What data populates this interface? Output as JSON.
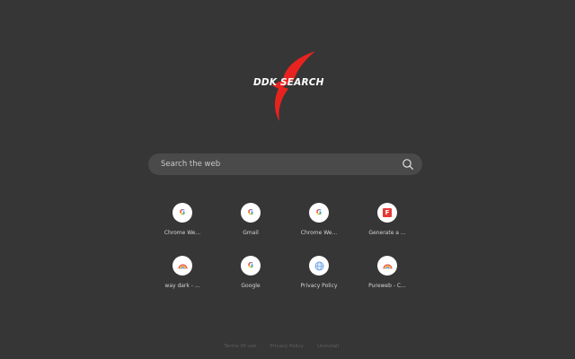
{
  "logo": {
    "text": "DDK SEARCH",
    "accent_color": "#e8231f"
  },
  "search": {
    "placeholder": "Search the web",
    "icon": "search-icon"
  },
  "shortcuts": [
    {
      "label": "Chrome We...",
      "icon": "google-g-icon"
    },
    {
      "label": "Gmail",
      "icon": "google-g-icon"
    },
    {
      "label": "Chrome We...",
      "icon": "google-g-icon"
    },
    {
      "label": "Generate a ...",
      "icon": "f-logo-icon"
    },
    {
      "label": "way dark - ...",
      "icon": "rainbow-icon"
    },
    {
      "label": "Google",
      "icon": "google-g-icon"
    },
    {
      "label": "Privacy Policy",
      "icon": "globe-icon"
    },
    {
      "label": "Pureweb - C...",
      "icon": "rainbow-icon"
    }
  ],
  "footer": {
    "links": [
      "Terms Of use",
      "Privacy Policy",
      "Uninstall"
    ]
  },
  "colors": {
    "background": "#363636",
    "search_bar": "#4a4a4a",
    "tile_circle": "#ffffff"
  }
}
